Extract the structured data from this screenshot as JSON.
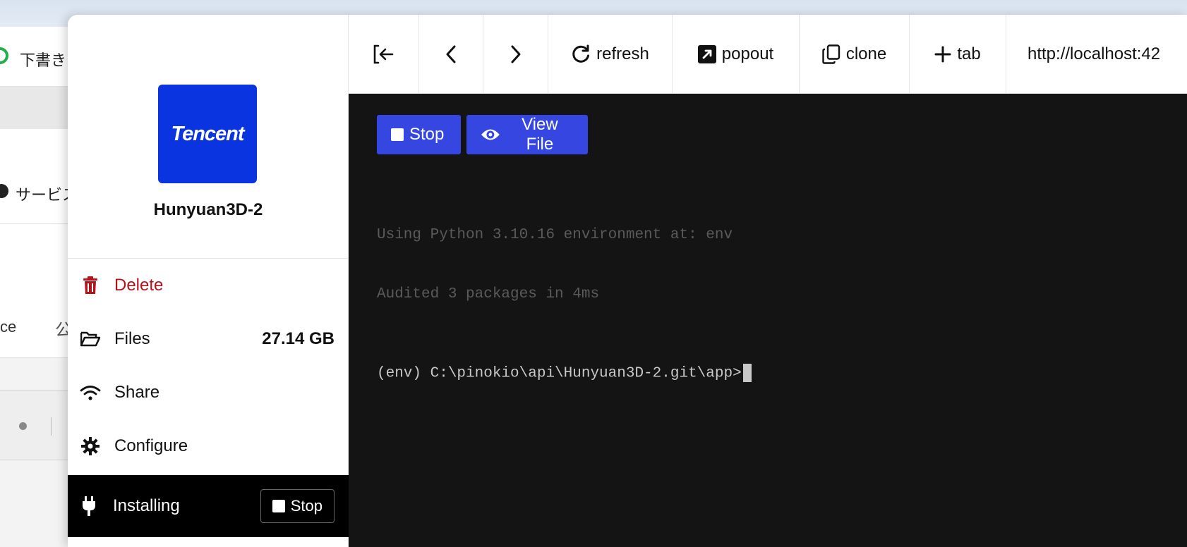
{
  "background_window": {
    "tab_text": "下書き",
    "panel_text": "サービス",
    "panel2_text": "ce",
    "panel2_glyph": "公"
  },
  "sidebar": {
    "app_logo_text": "Tencent",
    "app_name": "Hunyuan3D-2",
    "menu": {
      "delete": "Delete",
      "files": "Files",
      "files_size": "27.14 GB",
      "share": "Share",
      "configure": "Configure"
    },
    "status": {
      "label": "Installing",
      "stop_label": "Stop"
    }
  },
  "toolbar": {
    "refresh": "refresh",
    "popout": "popout",
    "clone": "clone",
    "tab": "tab",
    "url": "http://localhost:42"
  },
  "terminal": {
    "stop_label": "Stop",
    "view_file_label": "View File",
    "lines": [
      "Using Python 3.10.16 environment at: env",
      "Audited 3 packages in 4ms"
    ],
    "prompt": "(env) C:\\pinokio\\api\\Hunyuan3D-2.git\\app>"
  },
  "colors": {
    "accent_blue": "#3547e0",
    "tencent_blue": "#0a34e0",
    "delete_red": "#b3141c",
    "terminal_bg": "#141414"
  }
}
